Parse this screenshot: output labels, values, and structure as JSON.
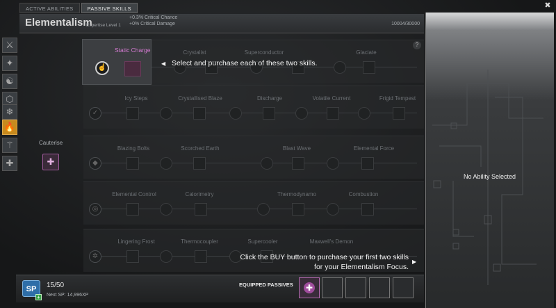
{
  "tabs": [
    "ACTIVE ABILITIES",
    "PASSIVE SKILLS"
  ],
  "header": {
    "title": "Elementalism",
    "expertise": "Expertise Level 1",
    "bonus1": "+0.3% Critical Chance",
    "bonus2": "+0% Critical Damage",
    "xp": "10004/30000"
  },
  "skills": {
    "row1": [
      "Static Charge",
      "Crystalist",
      "Superconductor",
      "Glaciate"
    ],
    "row2": [
      "Icy Steps",
      "Crystallised Blaze",
      "Discharge",
      "Volatile Current",
      "Frigid Tempest"
    ],
    "row3": [
      "Blazing Bolts",
      "Scorched Earth",
      "Blast Wave",
      "Elemental Force"
    ],
    "row4": [
      "Elemental Control",
      "Calorimetry",
      "Thermodynamo",
      "Combustion"
    ],
    "row5": [
      "Lingering Frost",
      "Thermocoupler",
      "Supercooler",
      "Maxwell's Demon"
    ]
  },
  "cauterise": "Cauterise",
  "tips": {
    "tip1": "Select and purchase each of these two skills.",
    "tip2_line1": "Click the BUY button to purchase your first two skills",
    "tip2_line2": "for your Elementalism Focus."
  },
  "right_panel": {
    "status": "No Ability Selected"
  },
  "bottom": {
    "sp_icon": "SP",
    "sp_count": "15/50",
    "next_sp": "Next SP: 14,996XP",
    "equipped_label": "EQUIPPED PASSIVES"
  }
}
